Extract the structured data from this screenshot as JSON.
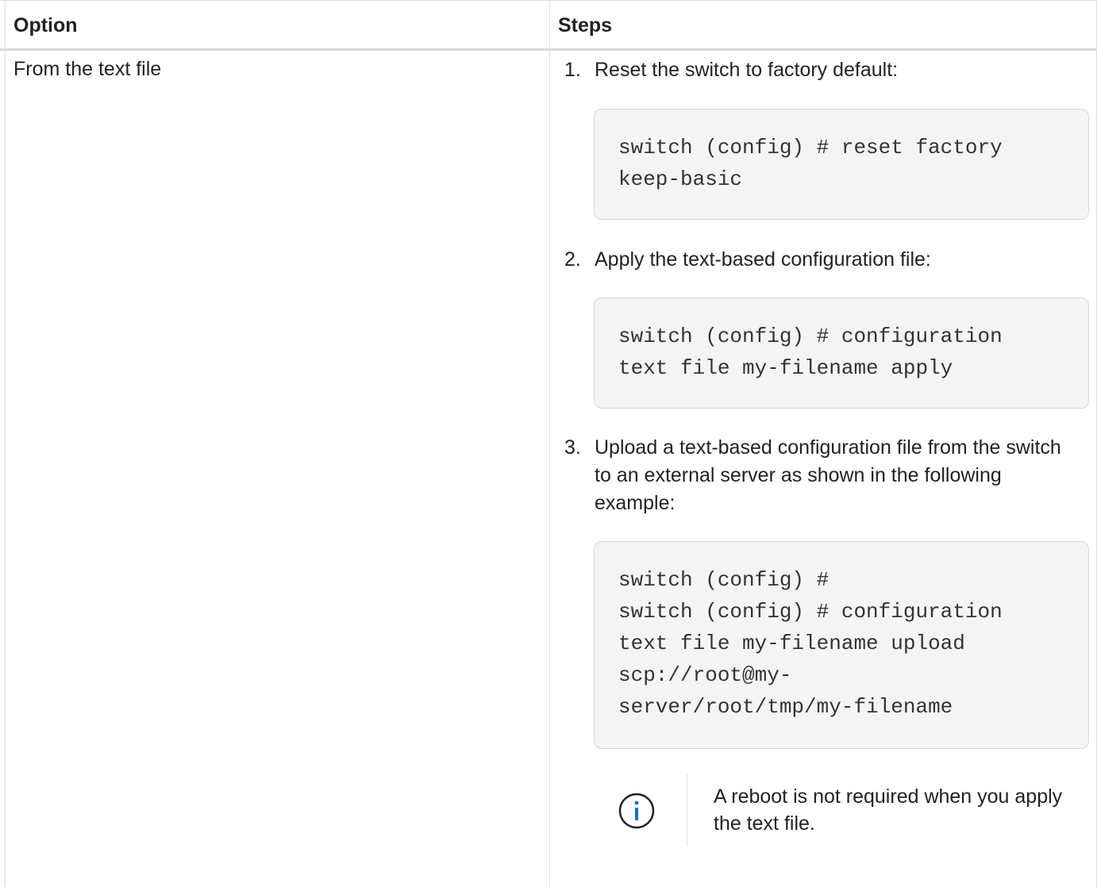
{
  "table": {
    "headers": {
      "option": "Option",
      "steps": "Steps"
    },
    "rows": [
      {
        "option": "From the text file",
        "steps": [
          {
            "number": "1.",
            "text": "Reset the switch to factory default:",
            "code": [
              "switch (config) # reset factory",
              "keep-basic"
            ]
          },
          {
            "number": "2.",
            "text": "Apply the text-based configuration file:",
            "code": [
              "switch (config) # configuration",
              "text file my-filename apply"
            ]
          },
          {
            "number": "3.",
            "text": "Upload a text-based configuration file from the switch to an external server as shown in the following example:",
            "code": [
              "switch (config) #",
              "switch (config) # configuration",
              "text file my-filename upload",
              "scp://root@my-",
              "server/root/tmp/my-filename"
            ]
          }
        ],
        "note": {
          "icon": "info-icon",
          "text": "A reboot is not required when you apply the text file."
        }
      }
    ]
  },
  "colors": {
    "icon_blue": "#1a6fc7",
    "code_bg": "#f4f4f4",
    "border": "#d9d9d9"
  }
}
